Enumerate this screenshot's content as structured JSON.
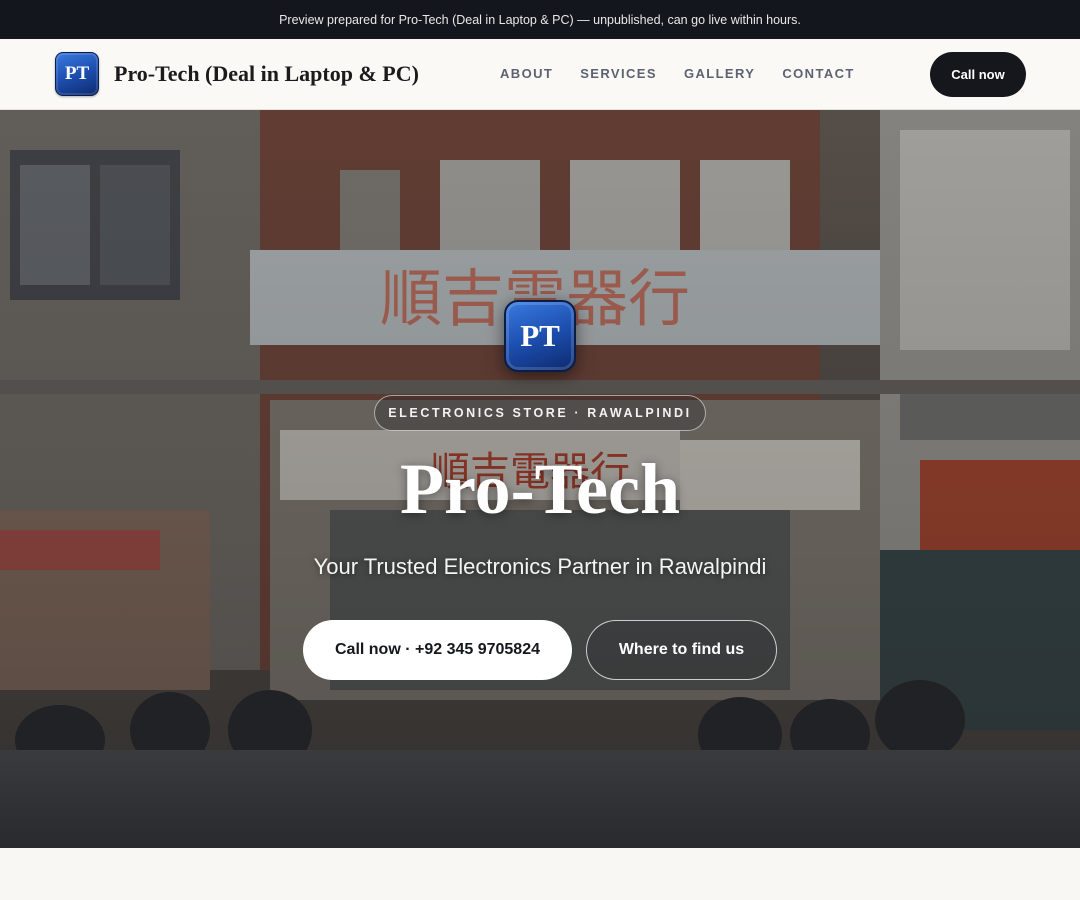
{
  "announcement": "Preview prepared for Pro-Tech (Deal in Laptop & PC) — unpublished, can go live within hours.",
  "brand": {
    "initials": "PT",
    "name": "Pro-Tech (Deal in Laptop & PC)"
  },
  "nav": {
    "links": [
      "ABOUT",
      "SERVICES",
      "GALLERY",
      "CONTACT"
    ],
    "cta": "Call now"
  },
  "hero": {
    "badge_initials": "PT",
    "eyebrow": "ELECTRONICS STORE · RAWALPINDI",
    "title": "Pro-Tech",
    "subtitle": "Your Trusted Electronics Partner in Rawalpindi",
    "primary_button": "Call now · +92 345 9705824",
    "secondary_button": "Where to find us"
  },
  "colors": {
    "topbar": "#13161c",
    "nav_background": "#faf9f6",
    "dark_button": "#15171c",
    "badge_blue": "#1d4fb0"
  }
}
